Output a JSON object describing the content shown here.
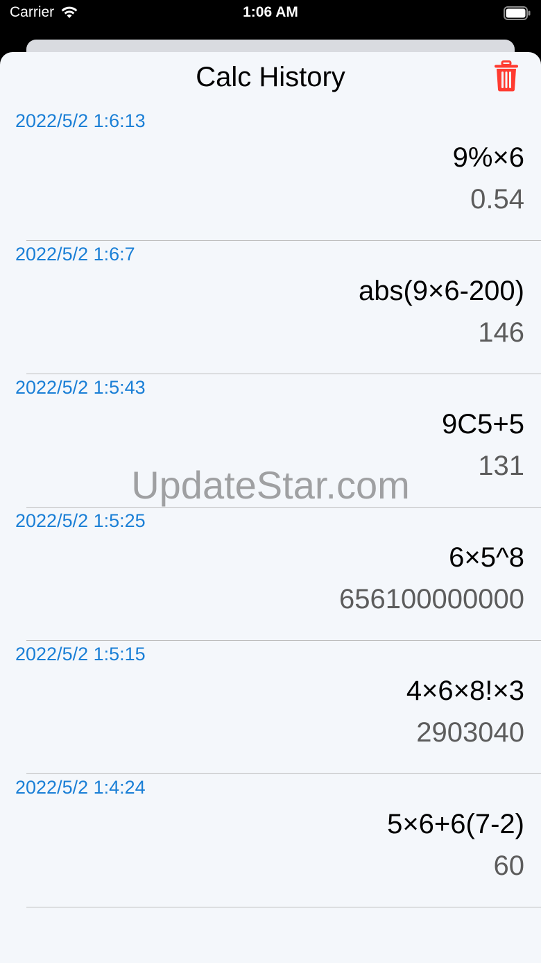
{
  "status_bar": {
    "carrier": "Carrier",
    "time": "1:06 AM",
    "wifi_icon": "wifi-icon",
    "battery_icon": "battery-icon"
  },
  "header": {
    "title": "Calc History",
    "delete_icon": "trash-icon",
    "delete_color": "#ff3b30"
  },
  "history": [
    {
      "time": "2022/5/2 1:6:13",
      "expression": "9%×6",
      "result": "0.54"
    },
    {
      "time": "2022/5/2 1:6:7",
      "expression": "abs(9×6-200)",
      "result": "146"
    },
    {
      "time": "2022/5/2 1:5:43",
      "expression": "9C5+5",
      "result": "131"
    },
    {
      "time": "2022/5/2 1:5:25",
      "expression": "6×5^8",
      "result": "656100000000"
    },
    {
      "time": "2022/5/2 1:5:15",
      "expression": "4×6×8!×3",
      "result": "2903040"
    },
    {
      "time": "2022/5/2 1:4:24",
      "expression": "5×6+6(7-2)",
      "result": "60"
    }
  ],
  "watermark": "UpdateStar.com",
  "colors": {
    "timestamp": "#1a7fd6",
    "result": "#5c5c5c",
    "sheet_bg": "#f4f7fb"
  }
}
